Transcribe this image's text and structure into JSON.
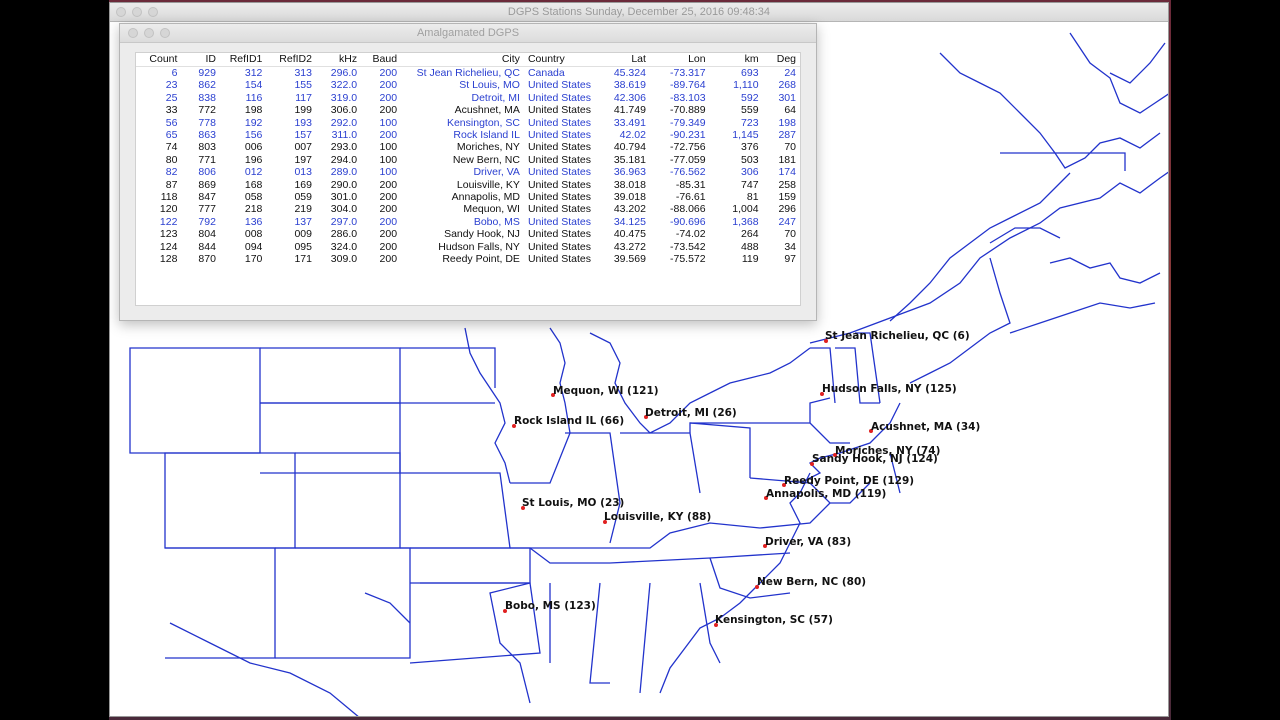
{
  "main_window": {
    "title": "DGPS Stations Sunday, December 25, 2016 09:48:34"
  },
  "table_window": {
    "title": "Amalgamated DGPS",
    "columns": [
      "Count",
      "ID",
      "RefID1",
      "RefID2",
      "kHz",
      "Baud",
      "City",
      "Country",
      "Lat",
      "Lon",
      "km",
      "Deg"
    ],
    "rows": [
      {
        "hl": true,
        "cells": [
          "6",
          "929",
          "312",
          "313",
          "296.0",
          "200",
          "St Jean Richelieu, QC",
          "Canada",
          "45.324",
          "-73.317",
          "693",
          "24"
        ]
      },
      {
        "hl": true,
        "cells": [
          "23",
          "862",
          "154",
          "155",
          "322.0",
          "200",
          "St Louis, MO",
          "United States",
          "38.619",
          "-89.764",
          "1,110",
          "268"
        ]
      },
      {
        "hl": true,
        "cells": [
          "25",
          "838",
          "116",
          "117",
          "319.0",
          "200",
          "Detroit, MI",
          "United States",
          "42.306",
          "-83.103",
          "592",
          "301"
        ]
      },
      {
        "hl": false,
        "cells": [
          "33",
          "772",
          "198",
          "199",
          "306.0",
          "200",
          "Acushnet, MA",
          "United States",
          "41.749",
          "-70.889",
          "559",
          "64"
        ]
      },
      {
        "hl": true,
        "cells": [
          "56",
          "778",
          "192",
          "193",
          "292.0",
          "100",
          "Kensington, SC",
          "United States",
          "33.491",
          "-79.349",
          "723",
          "198"
        ]
      },
      {
        "hl": true,
        "cells": [
          "65",
          "863",
          "156",
          "157",
          "311.0",
          "200",
          "Rock Island IL",
          "United States",
          "42.02",
          "-90.231",
          "1,145",
          "287"
        ]
      },
      {
        "hl": false,
        "cells": [
          "74",
          "803",
          "006",
          "007",
          "293.0",
          "100",
          "Moriches, NY",
          "United States",
          "40.794",
          "-72.756",
          "376",
          "70"
        ]
      },
      {
        "hl": false,
        "cells": [
          "80",
          "771",
          "196",
          "197",
          "294.0",
          "100",
          "New Bern, NC",
          "United States",
          "35.181",
          "-77.059",
          "503",
          "181"
        ]
      },
      {
        "hl": true,
        "cells": [
          "82",
          "806",
          "012",
          "013",
          "289.0",
          "100",
          "Driver, VA",
          "United States",
          "36.963",
          "-76.562",
          "306",
          "174"
        ]
      },
      {
        "hl": false,
        "cells": [
          "87",
          "869",
          "168",
          "169",
          "290.0",
          "200",
          "Louisville, KY",
          "United States",
          "38.018",
          "-85.31",
          "747",
          "258"
        ]
      },
      {
        "hl": false,
        "cells": [
          "118",
          "847",
          "058",
          "059",
          "301.0",
          "200",
          "Annapolis, MD",
          "United States",
          "39.018",
          "-76.61",
          "81",
          "159"
        ]
      },
      {
        "hl": false,
        "cells": [
          "120",
          "777",
          "218",
          "219",
          "304.0",
          "200",
          "Mequon, WI",
          "United States",
          "43.202",
          "-88.066",
          "1,004",
          "296"
        ]
      },
      {
        "hl": true,
        "cells": [
          "122",
          "792",
          "136",
          "137",
          "297.0",
          "200",
          "Bobo, MS",
          "United States",
          "34.125",
          "-90.696",
          "1,368",
          "247"
        ]
      },
      {
        "hl": false,
        "cells": [
          "123",
          "804",
          "008",
          "009",
          "286.0",
          "200",
          "Sandy Hook, NJ",
          "United States",
          "40.475",
          "-74.02",
          "264",
          "70"
        ]
      },
      {
        "hl": false,
        "cells": [
          "124",
          "844",
          "094",
          "095",
          "324.0",
          "200",
          "Hudson Falls, NY",
          "United States",
          "43.272",
          "-73.542",
          "488",
          "34"
        ]
      },
      {
        "hl": false,
        "cells": [
          "128",
          "870",
          "170",
          "171",
          "309.0",
          "200",
          "Reedy Point, DE",
          "United States",
          "39.569",
          "-75.572",
          "119",
          "97"
        ]
      }
    ]
  },
  "map": {
    "line_color": "#2233cc",
    "dot_color": "#e02020",
    "labels": [
      "St Jean Richelieu, QC (6)",
      "Hudson Falls, NY (125)",
      "Mequon, WI (121)",
      "Rock Island IL (66)",
      "Detroit, MI (26)",
      "Acushnet, MA (34)",
      "Moriches, NY (74)",
      "Sandy Hook, NJ (124)",
      "Reedy Point, DE (129)",
      "Annapolis, MD (119)",
      "St Louis, MO (23)",
      "Louisville, KY (88)",
      "Driver, VA (83)",
      "New Bern, NC (80)",
      "Bobo, MS (123)",
      "Kensington, SC (57)"
    ]
  }
}
